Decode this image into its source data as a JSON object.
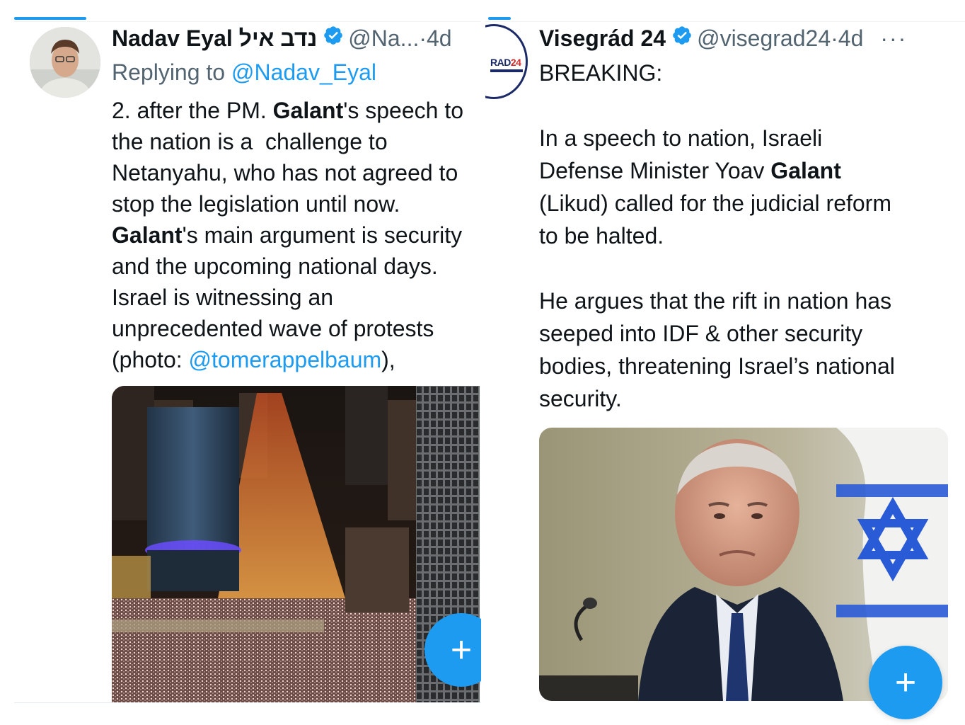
{
  "left_tweet": {
    "display_name": "Nadav Eyal נדב איל",
    "handle": "@Na...",
    "separator": "·",
    "time": "4d",
    "replying_prefix": "Replying to ",
    "replying_handle": "@Nadav_Eyal",
    "text": {
      "line1_pre": "2. after the PM. ",
      "line1_bold": "Galant",
      "line1_post": "'s speech to",
      "line2": "the nation is a  challenge to",
      "line3": "Netanyahu, who has not agreed to",
      "line4": "stop the legislation until now.",
      "line5_bold": "Galant",
      "line5_post": "'s main argument is security",
      "line6": "and the upcoming national days.",
      "line7": "Israel is witnessing an",
      "line8": "unprecedented wave of protests",
      "line9_pre": "(photo: ",
      "line9_link": "@tomerappelbaum",
      "line9_post": "),"
    },
    "fab_label": "+"
  },
  "right_tweet": {
    "display_name": "Visegrád 24",
    "handle": "@visegrad24",
    "separator": "·",
    "time": "4d",
    "more": "···",
    "logo_text_a": "RAD",
    "logo_text_b": "24",
    "text": {
      "line1": "BREAKING:",
      "line2": "In a speech to nation, Israeli",
      "line3_pre": "Defense Minister Yoav ",
      "line3_bold": "Galant",
      "line4": "(Likud) called for the judicial reform",
      "line5": "to be halted.",
      "line6": "He argues that the rift in nation has",
      "line7": "seeped into IDF & other security",
      "line8": "bodies, threatening Israel’s national",
      "line9": "security."
    },
    "fab_label": "+"
  },
  "colors": {
    "accent": "#1d9bf0",
    "text": "#0f1419",
    "secondary": "#536471"
  }
}
